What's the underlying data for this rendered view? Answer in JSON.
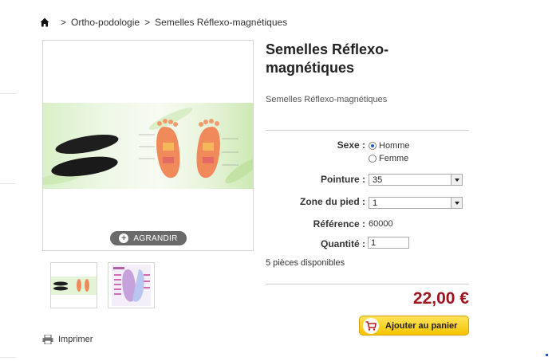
{
  "breadcrumb": {
    "home_icon": "home-icon",
    "separator": ">",
    "items": [
      "Ortho-podologie",
      "Semelles Réflexo-magnétiques"
    ]
  },
  "product": {
    "title_line1": "Semelles Réflexo-",
    "title_line2": "magnétiques",
    "short_description": "Semelles Réflexo-magnétiques",
    "zoom_label": "AGRANDIR",
    "print_label": "Imprimer"
  },
  "options": {
    "sexe_label": "Sexe :",
    "sexe_options": [
      "Homme",
      "Femme"
    ],
    "sexe_selected": "Homme",
    "pointure_label": "Pointure :",
    "pointure_value": "35",
    "zone_label": "Zone du pied :",
    "zone_value": "1",
    "reference_label": "Référence :",
    "reference_value": "60000",
    "quantite_label": "Quantité :",
    "quantite_value": "1"
  },
  "stock_text": "5 pièces disponibles",
  "price": "22,00 €",
  "cart_button_label": "Ajouter au panier",
  "colors": {
    "price": "#a0121d",
    "cart_button": "#f5c400"
  }
}
